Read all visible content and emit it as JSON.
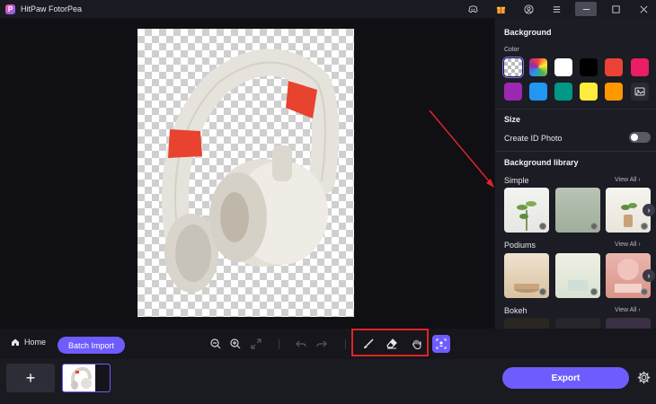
{
  "app": {
    "title": "HitPaw FotorPea",
    "logo_letter": "P"
  },
  "window_icons": [
    "discord-icon",
    "gift-icon",
    "account-icon",
    "menu-icon",
    "minimize-icon",
    "maximize-icon",
    "close-icon"
  ],
  "panel": {
    "background_title": "Background",
    "color_label": "Color",
    "swatches": [
      "transparent",
      "rainbow",
      "#ffffff",
      "#000000",
      "#ea4335",
      "#e91e63",
      "#9c27b0",
      "#2196f3",
      "#009688",
      "#ffeb3b",
      "#ff9800",
      "upload"
    ],
    "size_title": "Size",
    "create_id_label": "Create ID Photo",
    "create_id_on": false,
    "library_title": "Background library",
    "categories": [
      {
        "name": "Simple",
        "view_all": "View All"
      },
      {
        "name": "Podiums",
        "view_all": "View All"
      },
      {
        "name": "Bokeh",
        "view_all": "View All"
      }
    ]
  },
  "toolbar": {
    "home_label": "Home",
    "batch_label": "Batch Import"
  },
  "footer": {
    "add_label": "+",
    "export_label": "Export"
  },
  "colors": {
    "accent": "#6e5cff",
    "highlight": "#e02424"
  }
}
